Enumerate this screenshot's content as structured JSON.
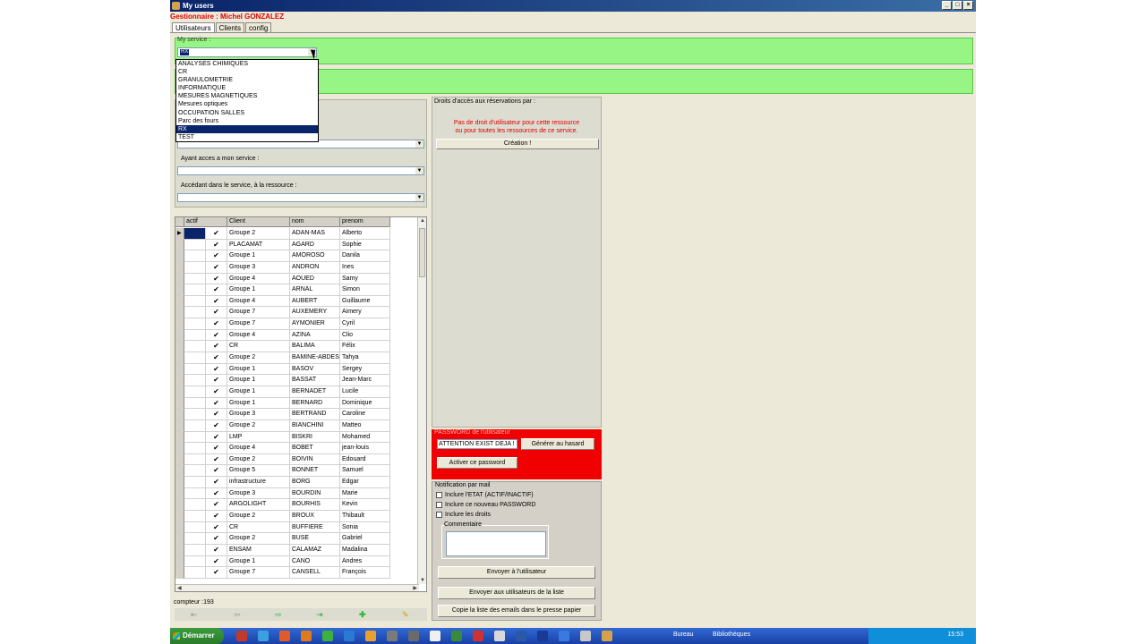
{
  "window": {
    "title": "My users"
  },
  "gestionnaire": "Gestionnaire : Michel GONZALEZ",
  "tabs": [
    "Utilisateurs",
    "Clients",
    "config"
  ],
  "myservice": {
    "label": "My service :",
    "selected": "RX",
    "options": [
      "ANALYSES CHIMIQUES",
      "CR",
      "GRANULOMETRIE",
      "INFORMATIQUE",
      "MESURES MAGNETIQUES",
      "Mesures optiques",
      "OCCUPATION SALLES",
      "Parc des fours",
      "RX",
      "TEST"
    ]
  },
  "filters": {
    "acces_service_label": "Ayant acces a mon service :",
    "ressource_label": "Accédant dans le service, à la ressource  :"
  },
  "grid": {
    "columns": [
      "actif",
      "Client",
      "nom",
      "prenom"
    ],
    "rows": [
      [
        "Groupe 2",
        "ADAN-MAS",
        "Alberto"
      ],
      [
        "PLACAMAT",
        "AGARD",
        "Sophie"
      ],
      [
        "Groupe 1",
        "AMOROSO",
        "Danila"
      ],
      [
        "Groupe 3",
        "ANDRON",
        "Ines"
      ],
      [
        "Groupe 4",
        "AOUED",
        "Samy"
      ],
      [
        "Groupe 1",
        "ARNAL",
        "Simon"
      ],
      [
        "Groupe 4",
        "AUBERT",
        "Guillaume"
      ],
      [
        "Groupe 7",
        "AUXEMERY",
        "Aimery"
      ],
      [
        "Groupe 7",
        "AYMONIER",
        "Cyril"
      ],
      [
        "Groupe 4",
        "AZINA",
        "Clio"
      ],
      [
        "CR",
        "BALIMA",
        "Félix"
      ],
      [
        "Groupe 2",
        "BAMINE-ABDES",
        "Tahya"
      ],
      [
        "Groupe 1",
        "BASOV",
        "Sergey"
      ],
      [
        "Groupe 1",
        "BASSAT",
        "Jean-Marc"
      ],
      [
        "Groupe 1",
        "BERNADET",
        "Lucile"
      ],
      [
        "Groupe 1",
        "BERNARD",
        "Dominique"
      ],
      [
        "Groupe 3",
        "BERTRAND",
        "Caroline"
      ],
      [
        "Groupe 2",
        "BIANCHINI",
        "Matteo"
      ],
      [
        "LMP",
        "BISKRI",
        "Mohamed"
      ],
      [
        "Groupe 4",
        "BOBET",
        "jean-louis"
      ],
      [
        "Groupe 2",
        "BOIVIN",
        "Edouard"
      ],
      [
        "Groupe 5",
        "BONNET",
        "Samuel"
      ],
      [
        "infrastructure",
        "BORG",
        "Edgar"
      ],
      [
        "Groupe 3",
        "BOURDIN",
        "Marie"
      ],
      [
        "ARGOLIGHT",
        "BOURHIS",
        "Kevin"
      ],
      [
        "Groupe 2",
        "BROUX",
        "Thibault"
      ],
      [
        "CR",
        "BUFFIERE",
        "Sonia"
      ],
      [
        "Groupe 2",
        "BUSE",
        "Gabriel"
      ],
      [
        "ENSAM",
        "CALAMAZ",
        "Madalina"
      ],
      [
        "Groupe 1",
        "CANO",
        "Andres"
      ],
      [
        "Groupe 7",
        "CANSELL",
        "François"
      ]
    ],
    "check": "✔"
  },
  "compteur": "compteur :193",
  "droits": {
    "title": "Droits d'accès aux réservations par :",
    "msg_line1": "Pas de droit d'utilisateur pour cette ressource",
    "msg_line2": "ou pour toutes les ressources de ce service.",
    "creation": "Création !"
  },
  "password": {
    "label": "PASSWORD de l'utilisateur",
    "value": "ATTENTION EXIST DEJA !",
    "generate": "Générer au hasard",
    "activate": "Activer ce password"
  },
  "notification": {
    "title": "Notification par mail",
    "opt1": "Inclure l'ETAT (ACTIF/INACTIF)",
    "opt2": "Inclure ce nouveau PASSWORD",
    "opt3": "Inclure les droits",
    "comment_label": "Commentaire",
    "send_user": "Envoyer à l'utilisateur",
    "send_list": "Envoyer aux utilisateurs de la liste",
    "copy_emails": "Copie la liste des emails dans le presse papier"
  },
  "taskbar": {
    "start": "Démarrer",
    "bureau": "Bureau",
    "bibliotheques": "Bibliothèques",
    "clock": "15:53"
  },
  "colors": {
    "green_panel": "#96f585",
    "red_panel": "#f00000",
    "error_text": "#e00000",
    "selection": "#0a246a"
  }
}
